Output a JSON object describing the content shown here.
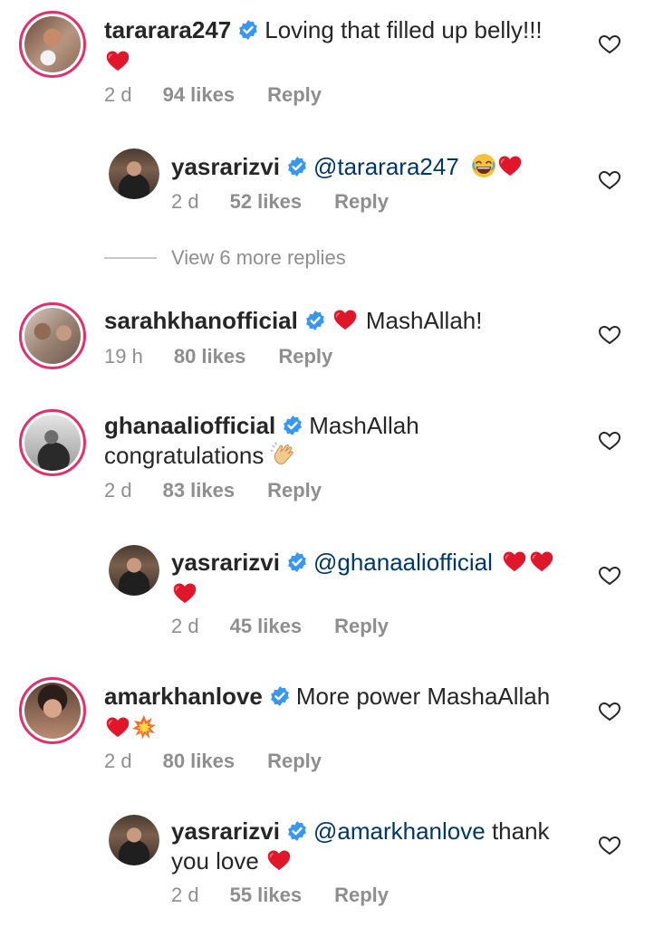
{
  "comments": [
    {
      "username": "tararara247",
      "text": "Loving that filled up belly!!!",
      "time": "2 d",
      "likes": "94 likes",
      "reply": "Reply"
    },
    {
      "username": "yasrarizvi",
      "mention": "@tararara247",
      "time": "2 d",
      "likes": "52 likes",
      "reply": "Reply"
    },
    {
      "username": "sarahkhanofficial",
      "text": "MashAllah!",
      "time": "19 h",
      "likes": "80 likes",
      "reply": "Reply"
    },
    {
      "username": "ghanaalioffical",
      "text": "MashAllah",
      "text2": "congratulations",
      "time": "2 d",
      "likes": "83 likes",
      "reply": "Reply"
    },
    {
      "username": "yasrarizvi",
      "mention": "@ghanaaliofficial",
      "time": "2 d",
      "likes": "45 likes",
      "reply": "Reply"
    },
    {
      "username": "amarkhanlove",
      "text": "More power MashaAllah",
      "time": "2 d",
      "likes": "80 likes",
      "reply": "Reply"
    },
    {
      "username": "yasrarizvi",
      "mention": "@amarkhanlove",
      "text": "thank",
      "text2": "you love",
      "time": "2 d",
      "likes": "55 likes",
      "reply": "Reply"
    }
  ],
  "view_more": "View 6 more replies",
  "colors": {
    "verified": "#3897f0",
    "heart": "#ed1c24",
    "mention": "#00376b",
    "muted": "#8e8e8e"
  }
}
